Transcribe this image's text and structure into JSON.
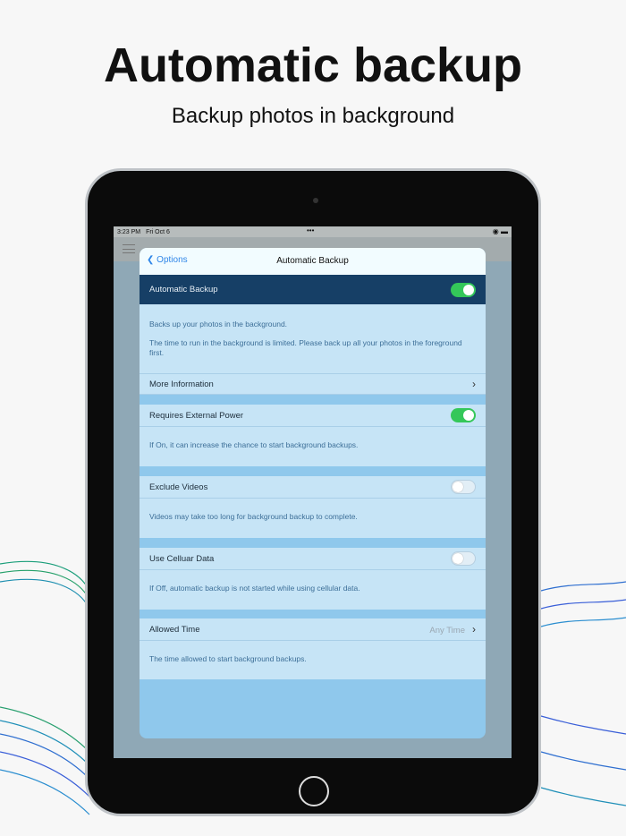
{
  "headline": "Automatic backup",
  "subheadline": "Backup photos in background",
  "status": {
    "time": "3:23 PM",
    "date": "Fri Oct 6",
    "dots": "•••",
    "icons": "wifi battery"
  },
  "modal": {
    "back_label": "Options",
    "title": "Automatic Backup",
    "main_toggle": {
      "label": "Automatic Backup",
      "on": true
    },
    "main_desc1": "Backs up your photos in the background.",
    "main_desc2": "The time to run in the background is limited. Please back up all your photos in the foreground first.",
    "more_info": "More Information",
    "settings": [
      {
        "label": "Requires External Power",
        "on": true,
        "desc": "If On, it can increase the chance to start background backups."
      },
      {
        "label": "Exclude Videos",
        "on": false,
        "desc": "Videos may take too long for background backup to complete."
      },
      {
        "label": "Use Celluar Data",
        "on": false,
        "desc": "If Off, automatic backup is not started while using cellular data."
      }
    ],
    "allowed_time": {
      "label": "Allowed Time",
      "value": "Any Time",
      "desc": "The time allowed to start background backups."
    }
  }
}
